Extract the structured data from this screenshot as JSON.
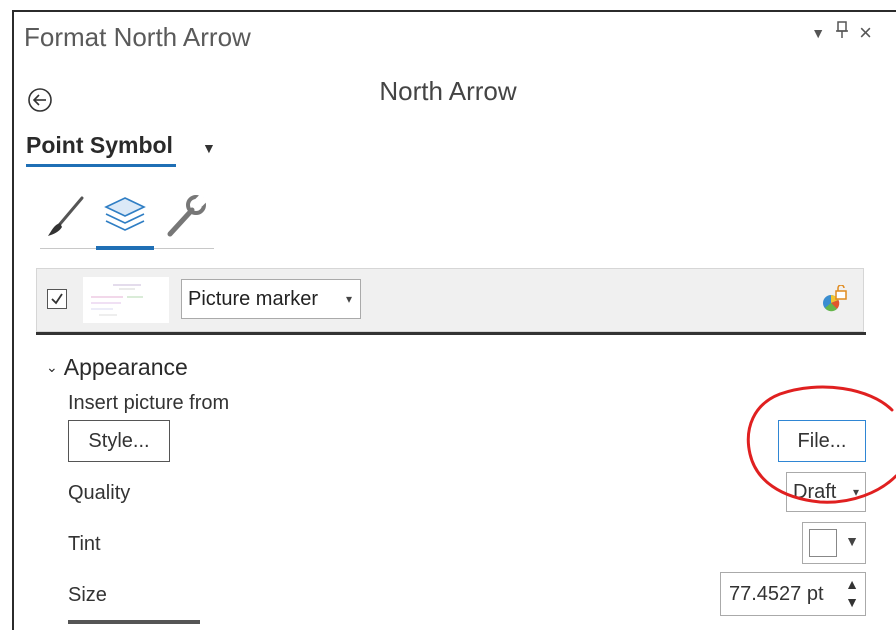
{
  "window": {
    "title": "Format North Arrow",
    "controls": [
      "▾",
      "ᵠ",
      "×"
    ]
  },
  "header": {
    "subtitle": "North Arrow",
    "point_symbol_label": "Point Symbol",
    "dropdown_glyph": "▼"
  },
  "tabs": {
    "items": [
      "paintbrush-icon",
      "layers-icon",
      "wrench-icon"
    ],
    "active_index": 1
  },
  "symbol_layer": {
    "checked": true,
    "type_select": "Picture marker",
    "caret": "▾"
  },
  "appearance": {
    "section_label": "Appearance",
    "insert_picture_label": "Insert picture from",
    "style_button": "Style...",
    "file_button": "File...",
    "quality_label": "Quality",
    "quality_value": "Draft",
    "tint_label": "Tint",
    "size_label": "Size",
    "size_value": "77.4527 pt"
  },
  "colors": {
    "accent": "#1f6fb5",
    "annotation": "#e02020"
  }
}
